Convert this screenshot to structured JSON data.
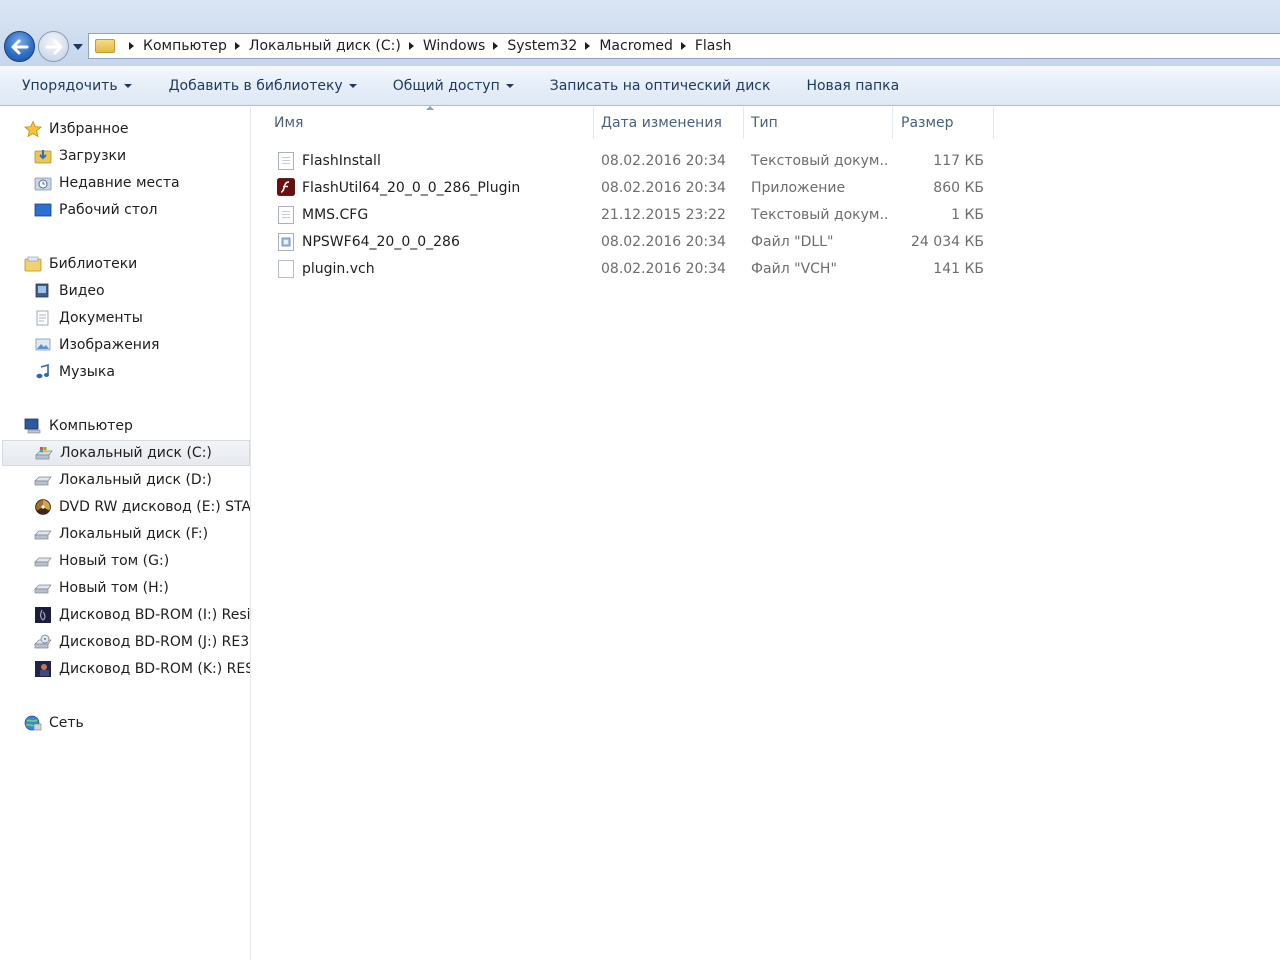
{
  "address_bar": {
    "crumbs": [
      "Компьютер",
      "Локальный диск (C:)",
      "Windows",
      "System32",
      "Macromed",
      "Flash"
    ]
  },
  "toolbar": {
    "organize": "Упорядочить",
    "add_to_library": "Добавить в библиотеку",
    "share": "Общий доступ",
    "burn": "Записать на оптический диск",
    "new_folder": "Новая папка"
  },
  "sidebar": {
    "favorites": {
      "label": "Избранное",
      "items": [
        "Загрузки",
        "Недавние места",
        "Рабочий стол"
      ]
    },
    "libraries": {
      "label": "Библиотеки",
      "items": [
        "Видео",
        "Документы",
        "Изображения",
        "Музыка"
      ]
    },
    "computer": {
      "label": "Компьютер",
      "items": [
        "Локальный диск (C:)",
        "Локальный диск (D:)",
        "DVD RW дисковод (E:) STALI",
        "Локальный диск (F:)",
        "Новый том (G:)",
        "Новый том (H:)",
        "Дисковод BD-ROM (I:) Resid",
        "Дисковод BD-ROM (J:) RE3",
        "Дисковод BD-ROM (K:) RESI"
      ],
      "selected_index": 0
    },
    "network": {
      "label": "Сеть"
    }
  },
  "file_list": {
    "columns": {
      "name": "Имя",
      "date": "Дата изменения",
      "type": "Тип",
      "size": "Размер"
    },
    "rows": [
      {
        "name": "FlashInstall",
        "date": "08.02.2016 20:34",
        "type": "Текстовый докум...",
        "size": "117 КБ",
        "icon": "text-file-icon"
      },
      {
        "name": "FlashUtil64_20_0_0_286_Plugin",
        "date": "08.02.2016 20:34",
        "type": "Приложение",
        "size": "860 КБ",
        "icon": "flash-app-icon"
      },
      {
        "name": "MMS.CFG",
        "date": "21.12.2015 23:22",
        "type": "Текстовый докум...",
        "size": "1 КБ",
        "icon": "text-file-icon"
      },
      {
        "name": "NPSWF64_20_0_0_286",
        "date": "08.02.2016 20:34",
        "type": "Файл \"DLL\"",
        "size": "24 034 КБ",
        "icon": "dll-file-icon"
      },
      {
        "name": "plugin.vch",
        "date": "08.02.2016 20:34",
        "type": "Файл \"VCH\"",
        "size": "141 КБ",
        "icon": "blank-file-icon"
      }
    ]
  },
  "colors": {
    "toolbar_text": "#1e395b",
    "header_text": "#4c607a",
    "secondary_text": "#6d6d6d"
  }
}
